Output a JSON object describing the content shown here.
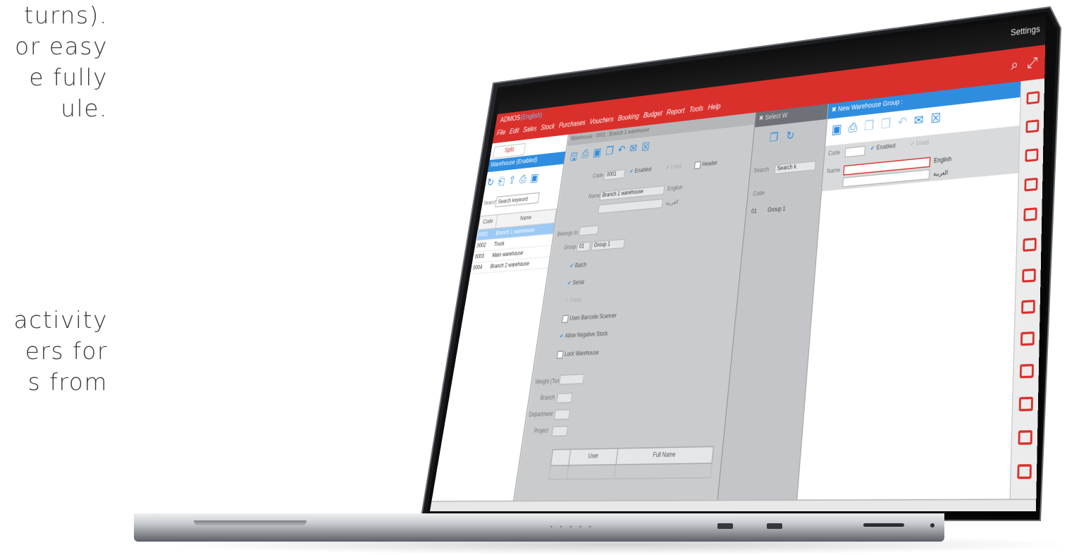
{
  "marketing": {
    "para1": [
      "turns).",
      "or easy",
      "e fully",
      "ule."
    ],
    "para2": [
      "activity",
      "ers for",
      "s from"
    ]
  },
  "app": {
    "topbar": {
      "settings_label": "Settings"
    },
    "header": {
      "logo": "ADMOS",
      "company": "(English)",
      "menu": [
        "File",
        "Edit",
        "Sales",
        "Stock",
        "Purchases",
        "Vouchers",
        "Booking",
        "Budget",
        "Report",
        "Tools",
        "Help"
      ]
    },
    "left_pane": {
      "split_label": "Split",
      "title": "Warehouse (Enabled)",
      "search_label": "Search",
      "search_placeholder": "Search keyword",
      "columns": [
        "Code",
        "Name"
      ],
      "rows": [
        {
          "code": "0001",
          "name": "Branch 1 warehouse",
          "selected": true
        },
        {
          "code": "0002",
          "name": "Truck",
          "selected": false
        },
        {
          "code": "0003",
          "name": "Main warehouse",
          "selected": false
        },
        {
          "code": "0004",
          "name": "Branch 2 warehouse",
          "selected": false
        }
      ]
    },
    "main_form": {
      "title": "Warehouse : 0001 : Branch 1 warehouse",
      "code_label": "Code",
      "code_value": "0001",
      "enabled_label": "Enabled",
      "used_label": "Used",
      "header_label": "Header",
      "name_label": "Name",
      "name_value": "Branch 1 warehouse",
      "english_label": "English",
      "arabic_label": "العربية",
      "belongs_label": "Belongs to",
      "group_label": "Group",
      "group_code": "01",
      "group_name": "Group 1",
      "checks": [
        "Batch",
        "Serial",
        "Fixed",
        "Uses Barcode Scanner",
        "Allow Negative Stock",
        "Lock Warehouse"
      ],
      "weight_label": "Weight (Ton)",
      "branch_label": "Branch",
      "department_label": "Department",
      "project_label": "Project",
      "grid_columns": [
        "User",
        "Full Name"
      ]
    },
    "select_pane": {
      "title": "Select W",
      "search_label": "Search",
      "search_value": "Search k",
      "code_label": "Code",
      "row_code": "01",
      "row_name": "Group 1"
    },
    "new_pane": {
      "title": "New Warehouse Group :",
      "code_label": "Code",
      "enabled_label": "Enabled",
      "used_label": "Used",
      "name_label": "Name",
      "english_label": "English",
      "arabic_label": "العربية"
    }
  }
}
